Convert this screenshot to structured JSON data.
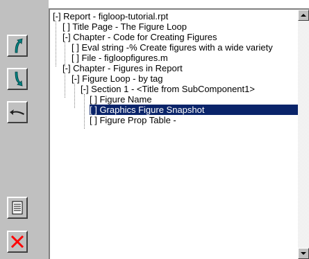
{
  "toolbar": {
    "buttons": [
      {
        "name": "move-up-button",
        "icon": "move-up-arrow-icon"
      },
      {
        "name": "move-down-button",
        "icon": "move-down-arrow-icon"
      },
      {
        "name": "move-left-button",
        "icon": "move-left-arrow-icon"
      },
      {
        "name": "properties-button",
        "icon": "properties-list-icon"
      },
      {
        "name": "delete-button",
        "icon": "delete-x-icon"
      }
    ],
    "colors": {
      "arrow": "#008080",
      "delete": "#ff0000"
    }
  },
  "tree": {
    "selected_color": "#0a246a",
    "items": [
      {
        "text": "[-] Report - figloop-tutorial.rpt",
        "level": 0,
        "selected": false
      },
      {
        "text": "[ ] Title Page - The Figure Loop",
        "level": 1,
        "selected": false
      },
      {
        "text": "[-] Chapter - Code for Creating Figures",
        "level": 1,
        "selected": false
      },
      {
        "text": "[ ] Eval string -% Create figures with a wide variety",
        "level": 2,
        "selected": false
      },
      {
        "text": "[ ] File - figloopfigures.m",
        "level": 2,
        "selected": false
      },
      {
        "text": "[-] Chapter - Figures in Report",
        "level": 1,
        "selected": false
      },
      {
        "text": "[-] Figure Loop - by tag",
        "level": 2,
        "selected": false
      },
      {
        "text": "[-] Section 1 - <Title from SubComponent1>",
        "level": 3,
        "selected": false
      },
      {
        "text": "[ ] Figure Name",
        "level": 4,
        "selected": false
      },
      {
        "text": "[ ] Graphics Figure Snapshot",
        "level": 4,
        "selected": true
      },
      {
        "text": "[ ] Figure Prop Table -",
        "level": 4,
        "selected": false
      }
    ]
  },
  "scrollbar": {
    "up_icon": "scroll-up-arrow-icon",
    "down_icon": "scroll-down-arrow-icon"
  }
}
